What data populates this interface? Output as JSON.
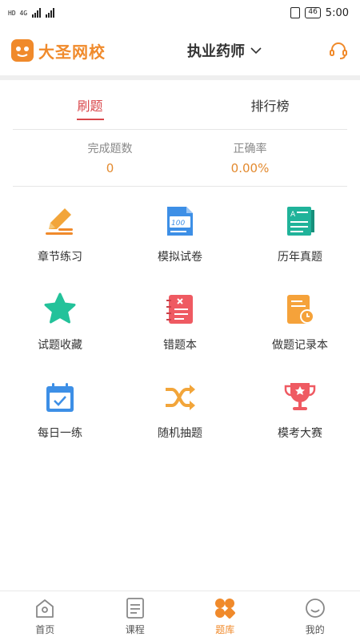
{
  "status": {
    "left_text": "HD 4G",
    "battery": "46",
    "time": "5:00"
  },
  "header": {
    "brand": "大圣网校",
    "title": "执业药师"
  },
  "tabs": [
    {
      "label": "刷题",
      "active": true
    },
    {
      "label": "排行榜",
      "active": false
    }
  ],
  "stats": [
    {
      "label": "完成题数",
      "value": "0"
    },
    {
      "label": "正确率",
      "value": "0.00%"
    }
  ],
  "features": [
    {
      "label": "章节练习",
      "icon": "pencil-icon"
    },
    {
      "label": "模拟试卷",
      "icon": "paper-100-icon"
    },
    {
      "label": "历年真题",
      "icon": "exam-book-icon"
    },
    {
      "label": "试题收藏",
      "icon": "star-icon"
    },
    {
      "label": "错题本",
      "icon": "wrong-notebook-icon"
    },
    {
      "label": "做题记录本",
      "icon": "record-clock-icon"
    },
    {
      "label": "每日一练",
      "icon": "calendar-check-icon"
    },
    {
      "label": "随机抽题",
      "icon": "shuffle-icon"
    },
    {
      "label": "模考大赛",
      "icon": "trophy-icon"
    }
  ],
  "nav": [
    {
      "label": "首页",
      "icon": "home-icon"
    },
    {
      "label": "课程",
      "icon": "course-icon"
    },
    {
      "label": "题库",
      "icon": "question-bank-icon",
      "active": true
    },
    {
      "label": "我的",
      "icon": "profile-icon"
    }
  ],
  "colors": {
    "brand": "#f08a2b",
    "tab_active": "#d9474b",
    "stat_value": "#e38a2f"
  }
}
